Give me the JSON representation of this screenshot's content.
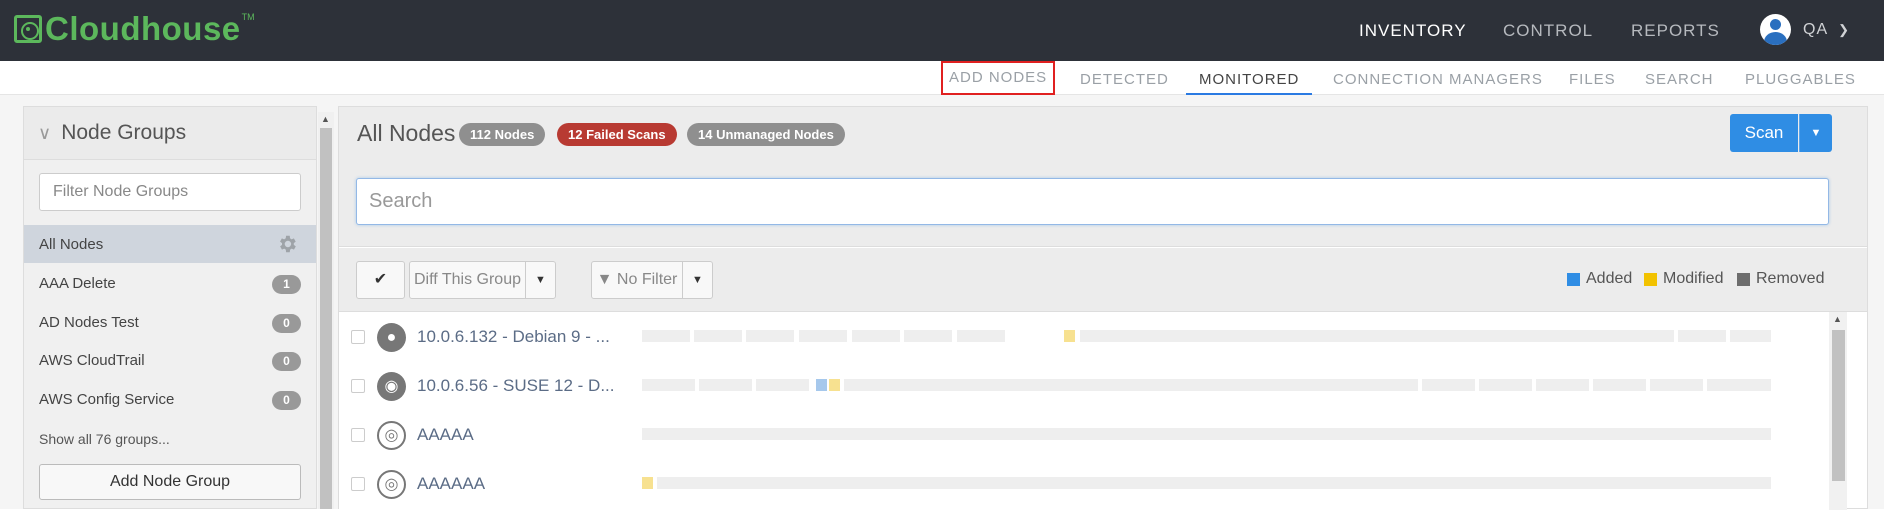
{
  "brand": {
    "name": "Cloudhouse",
    "tm": "TM",
    "color": "#5cb85c"
  },
  "topnav": [
    {
      "label": "INVENTORY",
      "active": true
    },
    {
      "label": "CONTROL",
      "active": false
    },
    {
      "label": "REPORTS",
      "active": false
    }
  ],
  "user": {
    "name": "QA",
    "icon": "user-avatar-icon"
  },
  "subnav": [
    {
      "label": "ADD NODES",
      "highlighted": true
    },
    {
      "label": "DETECTED"
    },
    {
      "label": "MONITORED",
      "active": true
    },
    {
      "label": "CONNECTION MANAGERS"
    },
    {
      "label": "FILES"
    },
    {
      "label": "SEARCH"
    },
    {
      "label": "PLUGGABLES"
    }
  ],
  "sidebar": {
    "title": "Node Groups",
    "filter_placeholder": "Filter Node Groups",
    "items": [
      {
        "label": "All Nodes",
        "active": true,
        "icon": "gear-icon"
      },
      {
        "label": "AAA Delete",
        "count": "1"
      },
      {
        "label": "AD Nodes Test",
        "count": "0"
      },
      {
        "label": "AWS CloudTrail",
        "count": "0"
      },
      {
        "label": "AWS Config Service",
        "count": "0"
      }
    ],
    "show_more": "Show all 76 groups...",
    "add_button": "Add Node Group"
  },
  "main": {
    "title": "All Nodes",
    "pills": [
      {
        "label": "112 Nodes",
        "color": "#8f8f8f"
      },
      {
        "label": "12 Failed Scans",
        "color": "#b83a32"
      },
      {
        "label": "14 Unmanaged Nodes",
        "color": "#8f8f8f"
      }
    ],
    "scan_label": "Scan",
    "search_placeholder": "Search",
    "toolbar": {
      "check_icon": "checkmark-icon",
      "diff_label": "Diff This Group",
      "filter_label": "No Filter"
    },
    "legend": [
      {
        "label": "Added",
        "color": "#2f8de4"
      },
      {
        "label": "Modified",
        "color": "#f2c200"
      },
      {
        "label": "Removed",
        "color": "#6d6d6d"
      }
    ],
    "rows": [
      {
        "name": "10.0.6.132 - Debian 9 - ...",
        "icon": "linux-penguin-icon"
      },
      {
        "name": "10.0.6.56 - SUSE 12 - D...",
        "icon": "suse-chameleon-icon"
      },
      {
        "name": "AAAAA",
        "icon": "globe-icon"
      },
      {
        "name": "AAAAAA",
        "icon": "globe-icon"
      }
    ]
  }
}
